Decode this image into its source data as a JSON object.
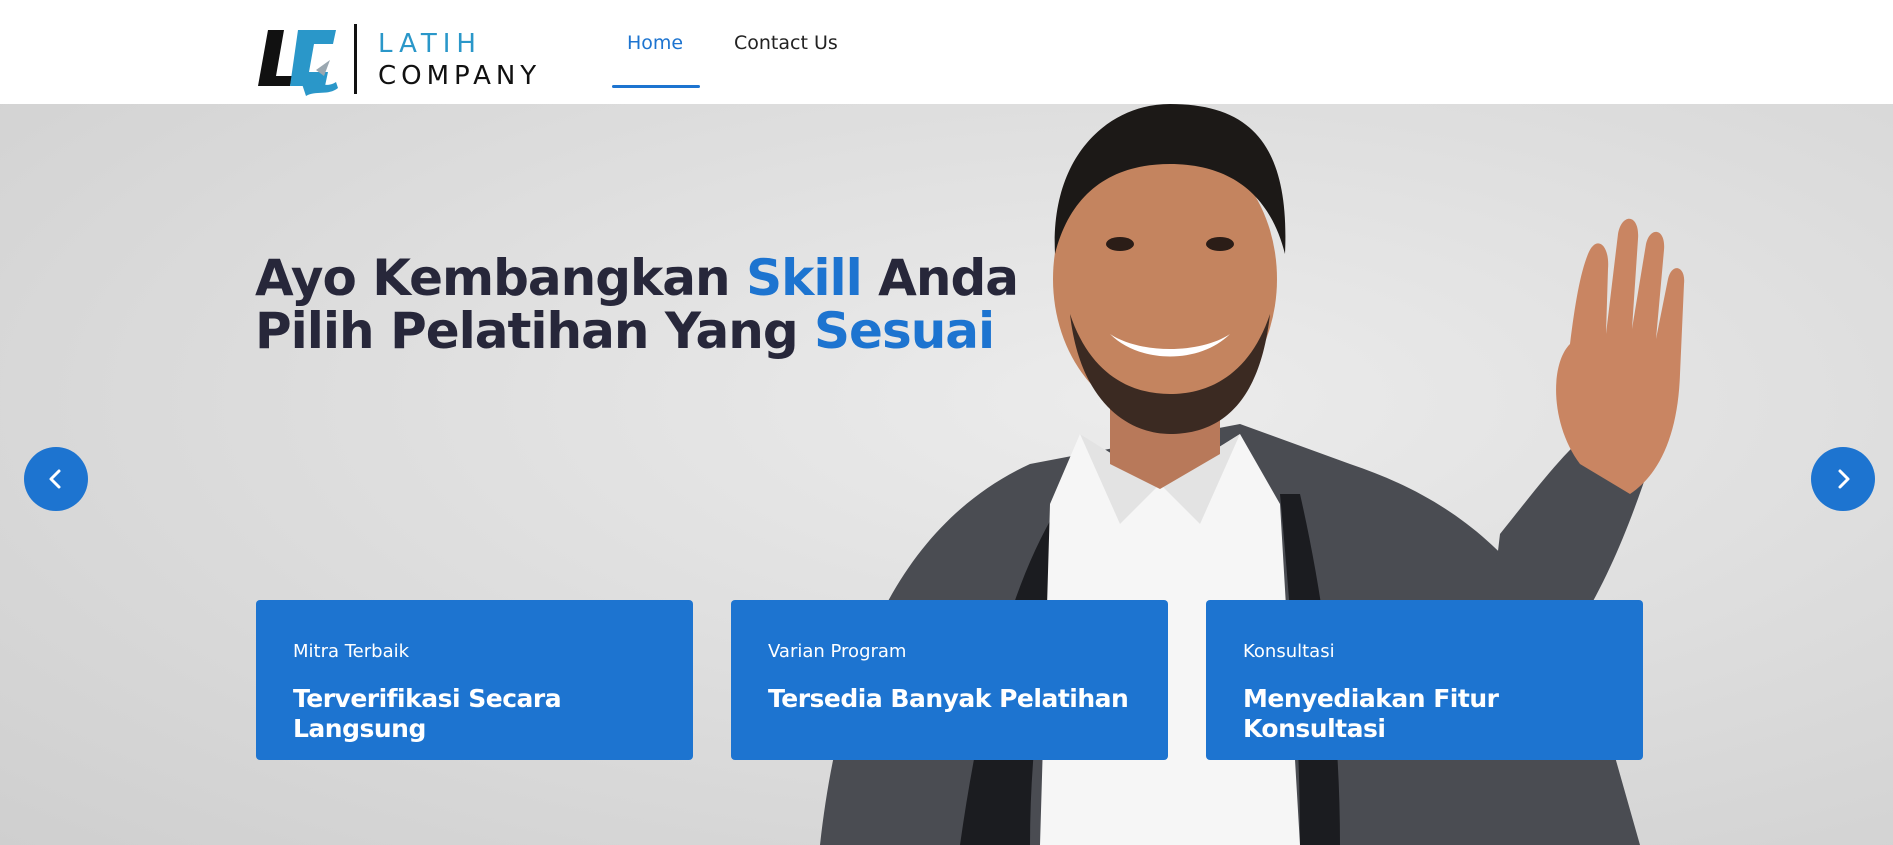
{
  "header": {
    "logo": {
      "line1": "LATIH",
      "line2": "COMPANY"
    },
    "nav": [
      {
        "label": "Home",
        "active": true
      },
      {
        "label": "Contact Us",
        "active": false
      }
    ]
  },
  "hero": {
    "headline_line1": {
      "part1": "Ayo Kembangkan ",
      "accent": "Skill",
      "part2": " Anda"
    },
    "headline_line2": {
      "part1": "Pilih Pelatihan Yang ",
      "accent": "Sesuai"
    },
    "prev_icon": "chevron-left-icon",
    "next_icon": "chevron-right-icon"
  },
  "cards": [
    {
      "label": "Mitra Terbaik",
      "title": "Terverifikasi Secara Langsung"
    },
    {
      "label": "Varian Program",
      "title": "Tersedia Banyak Pelatihan"
    },
    {
      "label": "Konsultasi",
      "title": "Menyediakan Fitur Konsultasi"
    }
  ],
  "colors": {
    "accent": "#1d74d0",
    "heading": "#27273a",
    "logo_blue": "#2a97c9",
    "hero_background": "#dcdcdc"
  }
}
